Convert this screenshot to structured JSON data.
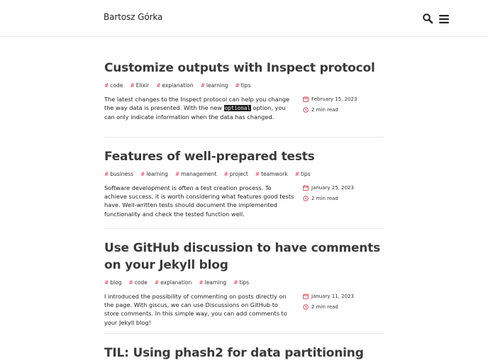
{
  "site": {
    "title": "Bartosz Górka"
  },
  "colors": {
    "accent": "#e8374a",
    "title": "#3a3a3a",
    "divider": "#e7e7e7"
  },
  "header": {
    "search_icon": "search-icon",
    "menu_icon": "hamburger-menu-icon"
  },
  "posts": [
    {
      "title": "Customize outputs with Inspect protocol",
      "tags": [
        "code",
        "Elixir",
        "explanation",
        "learning",
        "tips"
      ],
      "excerpt_before": "The latest changes to the Inspect protocol can help you change the way data is presented. With the new ",
      "excerpt_code": "optional",
      "excerpt_after": " option, you can only indicate information when the data has changed.",
      "date": "February 15, 2023",
      "read_time": "2 min read"
    },
    {
      "title": "Features of well-prepared tests",
      "tags": [
        "business",
        "learning",
        "management",
        "project",
        "teamwork",
        "tips"
      ],
      "excerpt": "Software development is often a test creation process. To achieve success, it is worth considering what features good tests have. Well-written tests should document the implemented functionality and check the tested function well.",
      "date": "January 25, 2023",
      "read_time": "2 min read"
    },
    {
      "title": "Use GitHub discussion to have comments on your Jekyll blog",
      "tags": [
        "blog",
        "code",
        "explanation",
        "learning",
        "tips"
      ],
      "excerpt": "I introduced the possibility of commenting on posts directly on the page. With giscus, we can use Discussions on GitHub to store comments. In this simple way, you can add comments to your Jekyll blog!",
      "date": "January 11, 2023",
      "read_time": "2 min read"
    },
    {
      "title": "TIL: Using phash2 for data partitioning"
    }
  ]
}
